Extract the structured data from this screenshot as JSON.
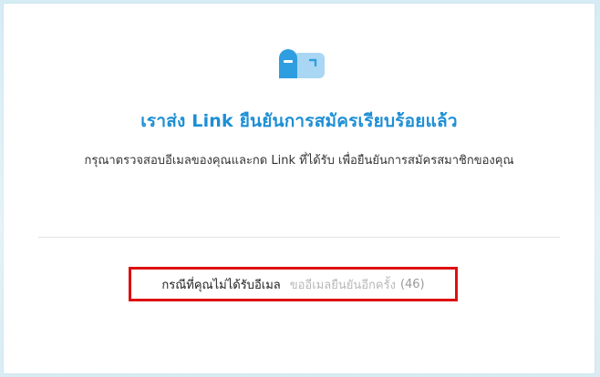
{
  "page": {
    "icon": "mailbox-icon",
    "headline": "เราส่ง Link ยืนยันการสมัครเรียบร้อยแล้ว",
    "instruction": "กรุณาตรวจสอบอีเมลของคุณและกด Link ที่ได้รับ เพื่อยืนยันการสมัครสมาชิกของคุณ",
    "resend": {
      "question": "กรณีที่คุณไม่ได้รับอีเมล",
      "link_label": "ขออีเมลยืนยันอีกครั้ง",
      "countdown": "(46)"
    }
  },
  "colors": {
    "accent": "#1d8fd4",
    "highlight_border": "#dd1010",
    "disabled_link": "#b8b8b8"
  }
}
